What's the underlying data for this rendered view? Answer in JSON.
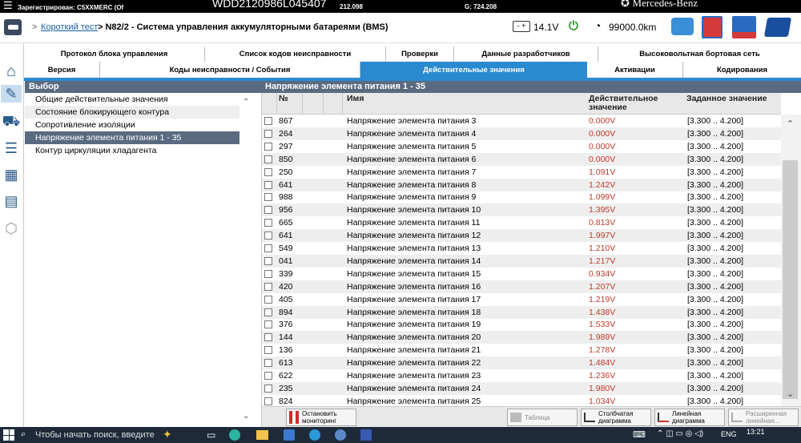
{
  "top": {
    "line1_left": "Зарегистрирован: C5XXMERC (Of",
    "vin": "WDD2120986L045407",
    "num": "212.098",
    "g_value": "G: 724.208",
    "brand": "Mercedes-Benz"
  },
  "title": {
    "short_test_link": "Короткий тест",
    "path": "> N82/2 - Система управления аккумуляторными батареями (BMS)",
    "voltage": "14.1V",
    "mileage": "99000.0km"
  },
  "tabs_row1": [
    "Протокол блока управления",
    "Список кодов неисправности",
    "Проверки",
    "Данные разработчиков",
    "Высоковольтная бортовая сеть"
  ],
  "tabs_row2": [
    "Версия",
    "Коды неисправности / События",
    "Действительные значения",
    "Активации",
    "Кодирования"
  ],
  "left": {
    "header": "Выбор",
    "items": [
      "Общие действительные значения",
      "Состояние блокирующего контура",
      "Сопротивление изоляции",
      "Напряжение элемента питания 1 - 35",
      "Контур циркуляции хладагента"
    ]
  },
  "right": {
    "header": "Напряжение элемента питания 1 - 35",
    "columns": {
      "num": "№",
      "name": "Имя",
      "actual": "Действительное значение",
      "target": "Заданное значение"
    },
    "rows": [
      {
        "num": "867",
        "name": "Напряжение элемента питания 3",
        "value": "0.000V",
        "target": "[3.300 .. 4.200]"
      },
      {
        "num": "264",
        "name": "Напряжение элемента питания 4",
        "value": "0.000V",
        "target": "[3.300 .. 4.200]"
      },
      {
        "num": "297",
        "name": "Напряжение элемента питания 5",
        "value": "0.000V",
        "target": "[3.300 .. 4.200]"
      },
      {
        "num": "850",
        "name": "Напряжение элемента питания 6",
        "value": "0.000V",
        "target": "[3.300 .. 4.200]"
      },
      {
        "num": "250",
        "name": "Напряжение элемента питания 7",
        "value": "1.091V",
        "target": "[3.300 .. 4.200]"
      },
      {
        "num": "641",
        "name": "Напряжение элемента питания 8",
        "value": "1.242V",
        "target": "[3.300 .. 4.200]"
      },
      {
        "num": "988",
        "name": "Напряжение элемента питания 9",
        "value": "1.099V",
        "target": "[3.300 .. 4.200]"
      },
      {
        "num": "956",
        "name": "Напряжение элемента питания 10",
        "value": "1.395V",
        "target": "[3.300 .. 4.200]"
      },
      {
        "num": "665",
        "name": "Напряжение элемента питания 11",
        "value": "0.813V",
        "target": "[3.300 .. 4.200]"
      },
      {
        "num": "641",
        "name": "Напряжение элемента питания 12",
        "value": "1.997V",
        "target": "[3.300 .. 4.200]"
      },
      {
        "num": "549",
        "name": "Напряжение элемента питания 13",
        "value": "1.210V",
        "target": "[3.300 .. 4.200]"
      },
      {
        "num": "041",
        "name": "Напряжение элемента питания 14",
        "value": "1.217V",
        "target": "[3.300 .. 4.200]"
      },
      {
        "num": "339",
        "name": "Напряжение элемента питания 15",
        "value": "0.934V",
        "target": "[3.300 .. 4.200]"
      },
      {
        "num": "420",
        "name": "Напряжение элемента питания 16",
        "value": "1.207V",
        "target": "[3.300 .. 4.200]"
      },
      {
        "num": "405",
        "name": "Напряжение элемента питания 17",
        "value": "1.219V",
        "target": "[3.300 .. 4.200]"
      },
      {
        "num": "894",
        "name": "Напряжение элемента питания 18",
        "value": "1.438V",
        "target": "[3.300 .. 4.200]"
      },
      {
        "num": "376",
        "name": "Напряжение элемента питания 19",
        "value": "1.533V",
        "target": "[3.300 .. 4.200]"
      },
      {
        "num": "144",
        "name": "Напряжение элемента питания 20",
        "value": "1.989V",
        "target": "[3.300 .. 4.200]"
      },
      {
        "num": "136",
        "name": "Напряжение элемента питания 21",
        "value": "1.278V",
        "target": "[3.300 .. 4.200]"
      },
      {
        "num": "613",
        "name": "Напряжение элемента питания 22",
        "value": "1.484V",
        "target": "[3.300 .. 4.200]"
      },
      {
        "num": "622",
        "name": "Напряжение элемента питания 23",
        "value": "1.236V",
        "target": "[3.300 .. 4.200]"
      },
      {
        "num": "235",
        "name": "Напряжение элемента питания 24",
        "value": "1.980V",
        "target": "[3.300 .. 4.200]"
      },
      {
        "num": "824",
        "name": "Напряжение элемента питания 25",
        "value": "1.034V",
        "target": "[3.300 .. 4.200]"
      }
    ]
  },
  "bottom": {
    "stop": "Остановить мониторинг",
    "table": "Таблица",
    "bar": "Столбчатая диаграмма",
    "line": "Линейная диаграмма",
    "ext": "Расширенная линейная..."
  },
  "taskbar": {
    "search": "Чтобы начать поиск, введите",
    "lang": "ENG",
    "time": "13:21"
  },
  "colors": {
    "accent": "#2a8ad0",
    "header": "#5a6a80",
    "error_value": "#c0392b"
  }
}
